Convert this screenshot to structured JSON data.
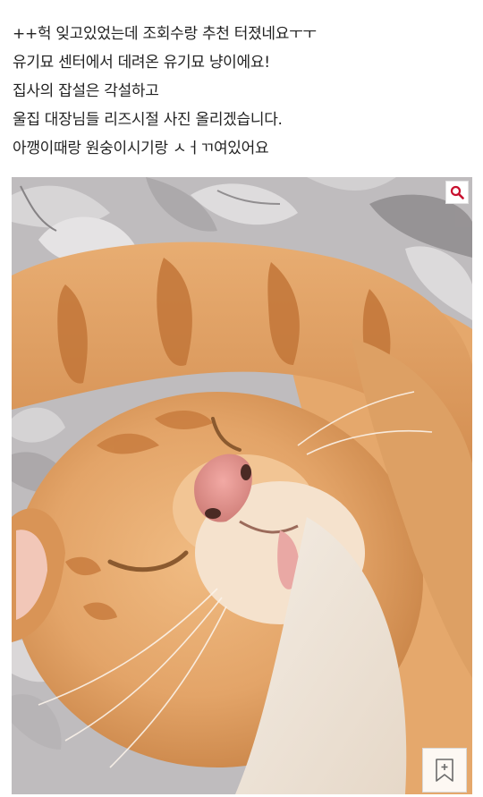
{
  "post": {
    "lines": [
      "++헉 잊고있었는데 조회수랑 추천 터졌네요ㅜㅜ",
      "유기묘 센터에서 데려온 유기묘 냥이에요!",
      "집사의 잡설은 각설하고",
      "울집 대장님들 리즈시절 사진 올리겠습니다.",
      "아깽이때랑 원숭이시기랑 ㅅㅓㄲ여있어요"
    ]
  },
  "photo": {
    "subject": "sleeping orange tabby cat covering face with paw",
    "zoom_icon": "magnifier-icon",
    "bookmark_icon": "bookmark-add-icon"
  },
  "colors": {
    "text": "#222222",
    "accent": "#c8102e",
    "fur_orange": "#e3a468",
    "fur_stripe": "#c77a3c",
    "blanket": "#bdbabc"
  }
}
